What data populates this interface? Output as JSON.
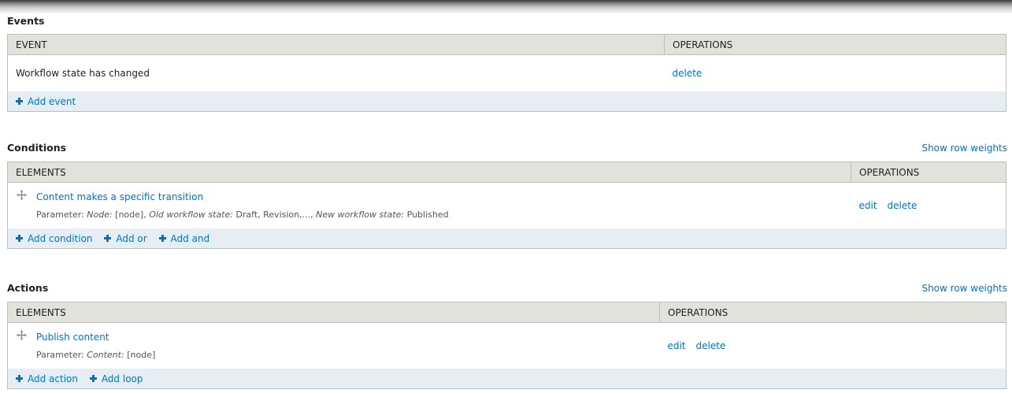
{
  "events": {
    "title": "Events",
    "columns": [
      "EVENT",
      "OPERATIONS"
    ],
    "rows": [
      {
        "label": "Workflow state has changed",
        "ops": [
          "delete"
        ]
      }
    ],
    "add_links": [
      "Add event"
    ]
  },
  "conditions": {
    "title": "Conditions",
    "row_weights": "Show row weights",
    "columns": [
      "ELEMENTS",
      "OPERATIONS"
    ],
    "rows": [
      {
        "label": "Content makes a specific transition",
        "param_prefix": "Parameter:",
        "params": [
          {
            "key": "Node:",
            "value": "[node],"
          },
          {
            "key": "Old workflow state:",
            "value": "Draft, Revision,...,"
          },
          {
            "key": "New workflow state:",
            "value": "Published"
          }
        ],
        "ops": [
          "edit",
          "delete"
        ]
      }
    ],
    "add_links": [
      "Add condition",
      "Add or",
      "Add and"
    ]
  },
  "actions": {
    "title": "Actions",
    "row_weights": "Show row weights",
    "columns": [
      "ELEMENTS",
      "OPERATIONS"
    ],
    "rows": [
      {
        "label": "Publish content",
        "param_prefix": "Parameter:",
        "params": [
          {
            "key": "Content:",
            "value": "[node]"
          }
        ],
        "ops": [
          "edit",
          "delete"
        ]
      }
    ],
    "add_links": [
      "Add action",
      "Add loop"
    ]
  },
  "icons": {
    "add": "plus-icon",
    "drag": "drag-handle-icon"
  },
  "colors": {
    "link": "#0074bd",
    "header_bg": "#e1e2dc",
    "add_row_bg": "#e6eef4",
    "border": "#bfbfba"
  }
}
